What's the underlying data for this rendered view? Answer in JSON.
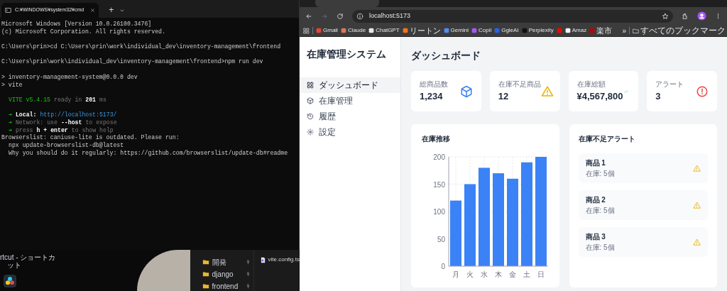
{
  "terminal": {
    "tab_title": "C:¥WINDOWS¥system32¥cmd",
    "new_tab": "+",
    "lines": [
      {
        "gap_before": false,
        "indent": false,
        "text": "Microsoft Windows [Version 10.0.26100.3476]"
      },
      {
        "gap_before": false,
        "indent": false,
        "text": "(c) Microsoft Corporation. All rights reserved."
      },
      {
        "gap_before": true,
        "indent": false,
        "text": "C:\\Users\\prin>cd C:\\Users\\prin\\work\\individual_dev\\inventory-management\\frontend"
      },
      {
        "gap_before": true,
        "indent": false,
        "text": "C:\\Users\\prin\\work\\individual_dev\\inventory-management\\frontend>npm run dev"
      },
      {
        "gap_before": true,
        "indent": false,
        "text": "> inventory-management-system@0.0.0 dev"
      },
      {
        "gap_before": false,
        "indent": false,
        "text": "> vite"
      },
      {
        "gap_before": true,
        "indent": true,
        "segments": [
          {
            "text": "VITE v5.4.15",
            "kind": "success"
          },
          {
            "text": "ready in",
            "kind": "dim"
          },
          {
            "text": "201",
            "kind": "strong"
          },
          {
            "text": "ms",
            "kind": "dim"
          }
        ]
      },
      {
        "gap_before": true,
        "indent": true,
        "segments": [
          {
            "text": "➜",
            "kind": "success"
          },
          {
            "text": "Local:",
            "kind": "strong"
          },
          {
            "text": "http://localhost:5173/",
            "kind": "link"
          }
        ]
      },
      {
        "gap_before": false,
        "indent": true,
        "segments": [
          {
            "text": "➜",
            "kind": "success"
          },
          {
            "text": "Network: use",
            "kind": "dim"
          },
          {
            "text": "--host",
            "kind": "strong"
          },
          {
            "text": "to expose",
            "kind": "dim"
          }
        ]
      },
      {
        "gap_before": false,
        "indent": true,
        "segments": [
          {
            "text": "➜",
            "kind": "success"
          },
          {
            "text": "press",
            "kind": "dim"
          },
          {
            "text": "h + enter",
            "kind": "strong"
          },
          {
            "text": "to show help",
            "kind": "dim"
          }
        ]
      },
      {
        "gap_before": false,
        "indent": false,
        "text": "Browserslist: caniuse-lite is outdated. Please run:"
      },
      {
        "gap_before": false,
        "indent": true,
        "text": "npx update-browserslist-db@latest"
      },
      {
        "gap_before": false,
        "indent": true,
        "text": "Why you should do it regularly: https://github.com/browserslist/update-db#readme"
      }
    ]
  },
  "desktop": {
    "shortcut_lines": [
      "rtcut - ショートカ",
      "ット"
    ],
    "explorer_folders": [
      {
        "label": "開発"
      },
      {
        "label": "django"
      },
      {
        "label": "frontend"
      }
    ],
    "explorer_files": [
      {
        "label": "vite.config.ts"
      }
    ]
  },
  "browser": {
    "address": "localhost:5173",
    "bookmarks": [
      {
        "label": "Gmail",
        "color": "#ea4335"
      },
      {
        "label": "Claude",
        "color": "#d97757"
      },
      {
        "label": "ChatGPT",
        "color": "#e5e7eb"
      },
      {
        "label": "リートン",
        "color": "#f97316"
      },
      {
        "label": "Gemini",
        "color": "#4f8df5"
      },
      {
        "label": "Copil",
        "color": "#a855f7"
      },
      {
        "label": "GgleAI",
        "color": "#2563eb"
      },
      {
        "label": "Perplexity",
        "color": "#111111"
      },
      {
        "color": "#ff0000"
      },
      {
        "label": "Amaz",
        "color": "#f3f4f6"
      },
      {
        "label": "楽市",
        "color": "#bf0000"
      }
    ],
    "more": "»",
    "all_bookmarks": "すべてのブックマーク"
  },
  "app": {
    "title": "在庫管理システム",
    "nav": [
      {
        "label": "ダッシュボード",
        "selected": true
      },
      {
        "label": "在庫管理",
        "selected": false
      },
      {
        "label": "履歴",
        "selected": false
      },
      {
        "label": "設定",
        "selected": false
      }
    ],
    "heading": "ダッシュボード",
    "stats": [
      {
        "label": "総商品数",
        "value": "1,234"
      },
      {
        "label": "在庫不足商品",
        "value": "12"
      },
      {
        "label": "在庫総額",
        "value": "¥4,567,800"
      },
      {
        "label": "アラート",
        "value": "3"
      }
    ],
    "trend": {
      "title": "在庫推移",
      "chart_data": {
        "type": "bar",
        "categories": [
          "月",
          "火",
          "水",
          "木",
          "金",
          "土",
          "日"
        ],
        "series": [
          {
            "color": "#3b82f6",
            "values": [
              120,
              150,
              180,
              170,
              160,
              190,
              200
            ]
          }
        ],
        "ylim": [
          0,
          200
        ],
        "yticks": [
          0,
          50,
          100,
          150,
          200
        ],
        "grid": true
      }
    },
    "alerts": {
      "title": "在庫不足アラート",
      "items": [
        {
          "name": "商品 1",
          "detail": "在庫: 5個"
        },
        {
          "name": "商品 2",
          "detail": "在庫: 5個"
        },
        {
          "name": "商品 3",
          "detail": "在庫: 5個"
        }
      ]
    }
  }
}
